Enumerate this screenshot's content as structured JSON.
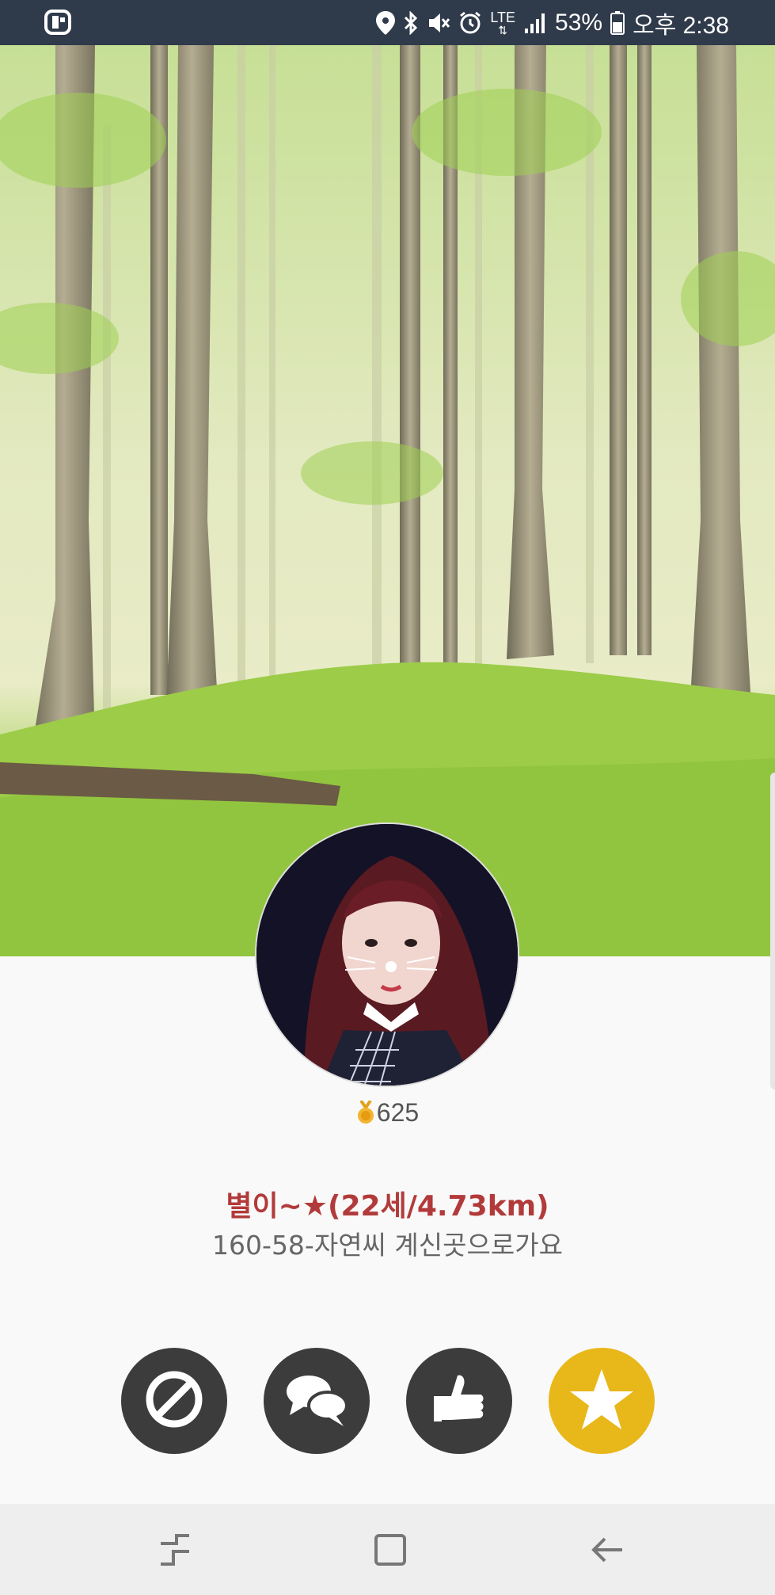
{
  "status_bar": {
    "battery": "53%",
    "time": "오후 2:38",
    "network": "LTE",
    "icons": [
      "app-icon",
      "location-icon",
      "bluetooth-icon",
      "mute-icon",
      "alarm-icon",
      "lte-icon",
      "signal-icon",
      "battery-icon"
    ]
  },
  "profile": {
    "points": "625",
    "name": "별이~★(22세/4.73km)",
    "status": "160-58-자연씨 계신곳으로가요"
  },
  "actions": [
    {
      "name": "block-button",
      "icon": "block-icon",
      "color": "#3c3c3c"
    },
    {
      "name": "chat-button",
      "icon": "chat-bubbles-icon",
      "color": "#3c3c3c"
    },
    {
      "name": "like-button",
      "icon": "thumbs-up-icon",
      "color": "#3c3c3c"
    },
    {
      "name": "favorite-button",
      "icon": "star-icon",
      "color": "#e8b71a"
    }
  ],
  "nav": [
    "recent-apps-icon",
    "home-icon",
    "back-icon"
  ],
  "colors": {
    "status_bar_bg": "#2f3a4a",
    "name_color": "#b23a3a",
    "favorite_yellow": "#e8b71a",
    "action_dark": "#3c3c3c",
    "nav_bg": "#eeeeee"
  }
}
